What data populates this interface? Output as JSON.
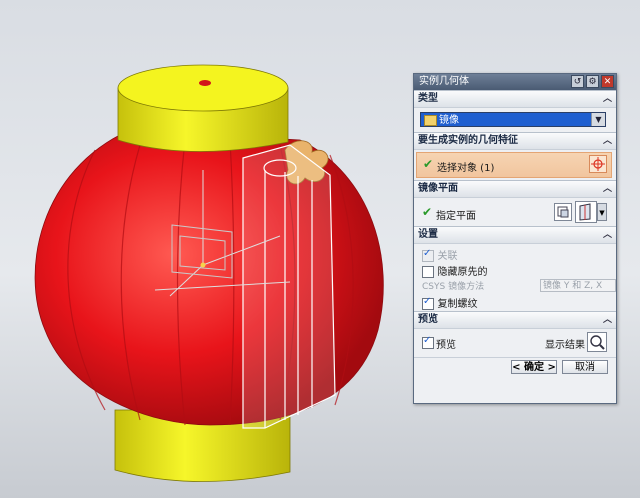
{
  "dialog": {
    "title": "实例几何体",
    "sections": {
      "type": {
        "header": "类型",
        "dropdown_value": "镜像"
      },
      "geometry": {
        "header": "要生成实例的几何特征",
        "select_label": "选择对象 (1)"
      },
      "mirror_plane": {
        "header": "镜像平面",
        "specify_label": "指定平面"
      },
      "settings": {
        "header": "设置",
        "associative_label": "关联",
        "hide_original_label": "隐藏原先的",
        "csys_method_label": "CSYS 镜像方法",
        "csys_method_value": "镜像 Y 和 Z, X",
        "copy_threads_label": "复制螺纹"
      },
      "preview": {
        "header": "预览",
        "preview_label": "预览",
        "show_result_label": "显示结果"
      }
    },
    "buttons": {
      "ok": "< 确定 >",
      "cancel": "取消"
    }
  },
  "colors": {
    "lantern_red": "#e8141a",
    "lantern_cap_yellow": "#f2f21f",
    "title_bar": "#4a5b73",
    "selection_highlight": "#f1c59e"
  }
}
